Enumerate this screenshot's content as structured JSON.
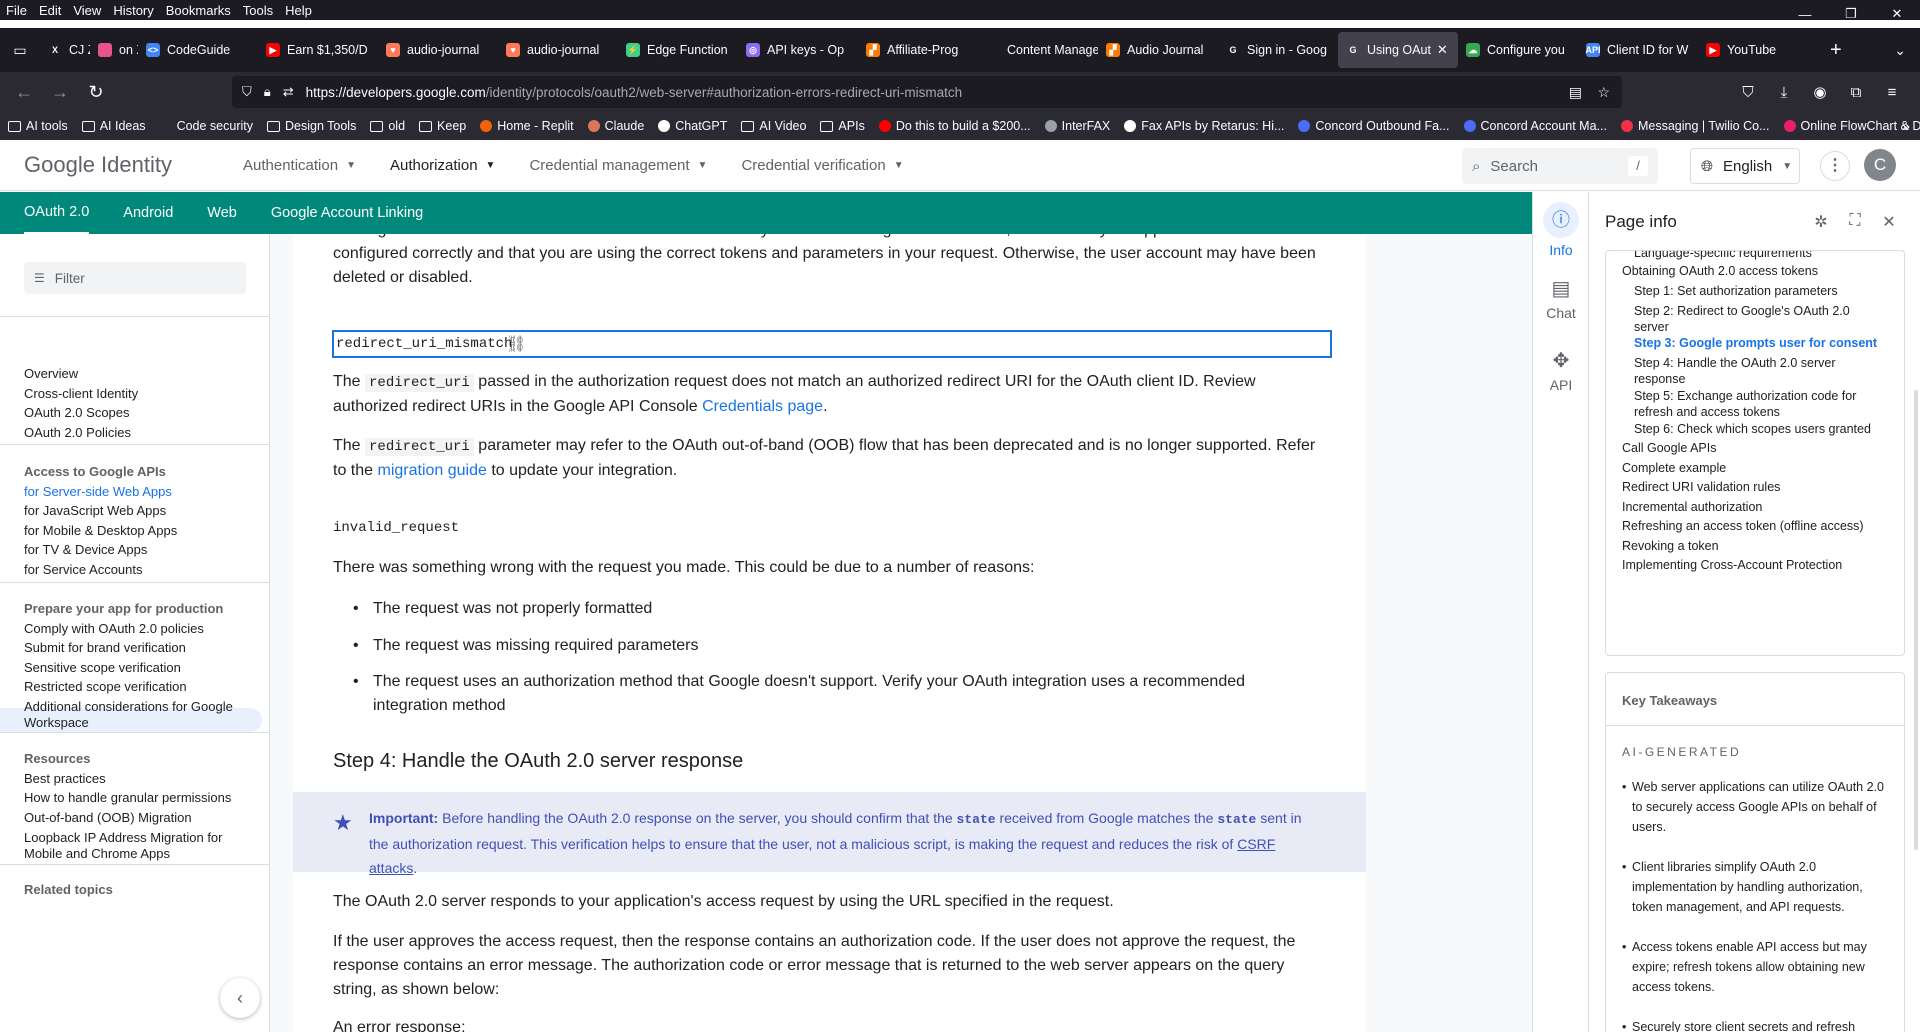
{
  "menubar": {
    "items": [
      "File",
      "Edit",
      "View",
      "History",
      "Bookmarks",
      "Tools",
      "Help"
    ]
  },
  "tabs": [
    {
      "label": "CJ Z",
      "fav_color": "#ffffff",
      "fav_text": "X"
    },
    {
      "label": "on X",
      "fav_color": "#e8538a",
      "fav_text": ""
    },
    {
      "label": "CodeGuide",
      "fav_color": "#4285f4",
      "fav_text": "<>"
    },
    {
      "label": "Earn $1,350/D",
      "fav_color": "#ff0000",
      "fav_text": "▶"
    },
    {
      "label": "audio-journal",
      "fav_color": "#ff7a59",
      "fav_text": "♥"
    },
    {
      "label": "audio-journal",
      "fav_color": "#ff7a59",
      "fav_text": "♥"
    },
    {
      "label": "Edge Function",
      "fav_color": "#3ecf8e",
      "fav_text": "⚡"
    },
    {
      "label": "API keys - Op",
      "fav_color": "#8e6cef",
      "fav_text": "◎"
    },
    {
      "label": "Affiliate-Prog",
      "fav_color": "#ff7a00",
      "fav_text": "▞"
    },
    {
      "label": "Content Manager",
      "fav_color": "#1c1b22",
      "fav_text": ""
    },
    {
      "label": "Audio Journal",
      "fav_color": "#ff7a00",
      "fav_text": "▞"
    },
    {
      "label": "Sign in - Goog",
      "fav_color": "#ffffff",
      "fav_text": "G"
    },
    {
      "label": "Using OAut",
      "fav_color": "#ffffff",
      "fav_text": "G",
      "active": true
    },
    {
      "label": "Configure you",
      "fav_color": "#34a853",
      "fav_text": "☁"
    },
    {
      "label": "Client ID for W",
      "fav_color": "#4285f4",
      "fav_text": "API"
    },
    {
      "label": "YouTube",
      "fav_color": "#ff0000",
      "fav_text": "▶"
    }
  ],
  "url": {
    "host": "https://developers.google.com",
    "path": "/identity/protocols/oauth2/web-server#authorization-errors-redirect-uri-mismatch"
  },
  "bookmarks": [
    {
      "label": "AI tools",
      "type": "folder"
    },
    {
      "label": "AI Ideas",
      "type": "folder"
    },
    {
      "label": "Code security",
      "type": "site",
      "color": "#2b2a33"
    },
    {
      "label": "Design Tools",
      "type": "folder"
    },
    {
      "label": "old",
      "type": "folder"
    },
    {
      "label": "Keep",
      "type": "folder"
    },
    {
      "label": "Home - Replit",
      "type": "site",
      "color": "#f26207"
    },
    {
      "label": "Claude",
      "type": "site",
      "color": "#d97757"
    },
    {
      "label": "ChatGPT",
      "type": "site",
      "color": "#ffffff"
    },
    {
      "label": "AI Video",
      "type": "folder"
    },
    {
      "label": "APIs",
      "type": "folder"
    },
    {
      "label": "Do this to build a $200...",
      "type": "site",
      "color": "#ff0000"
    },
    {
      "label": "InterFAX",
      "type": "site",
      "color": "#9aa0a6"
    },
    {
      "label": "Fax APIs by Retarus: Hi...",
      "type": "site",
      "color": "#ffffff"
    },
    {
      "label": "Concord Outbound Fa...",
      "type": "site",
      "color": "#4a6cf7"
    },
    {
      "label": "Concord Account Ma...",
      "type": "site",
      "color": "#4a6cf7"
    },
    {
      "label": "Messaging | Twilio Co...",
      "type": "site",
      "color": "#f22f46"
    },
    {
      "label": "Online FlowChart & Di...",
      "type": "site",
      "color": "#e91e63"
    }
  ],
  "gheader": {
    "logo": "Google Identity",
    "nav": [
      "Authentication",
      "Authorization",
      "Credential management",
      "Credential verification"
    ],
    "active_nav": "Authorization",
    "search_placeholder": "Search",
    "search_shortcut": "/",
    "language": "English",
    "avatar": "C"
  },
  "subnav": [
    "OAuth 2.0",
    "Android",
    "Web",
    "Google Account Linking"
  ],
  "leftnav": {
    "filter_placeholder": "Filter",
    "items": [
      {
        "label": "Overview"
      },
      {
        "label": "Cross-client Identity"
      },
      {
        "label": "OAuth 2.0 Scopes"
      },
      {
        "label": "OAuth 2.0 Policies"
      },
      {
        "label": "Access to Google APIs",
        "head": true
      },
      {
        "label": "for Server-side Web Apps",
        "selected": true
      },
      {
        "label": "for JavaScript Web Apps"
      },
      {
        "label": "for Mobile & Desktop Apps"
      },
      {
        "label": "for TV & Device Apps"
      },
      {
        "label": "for Service Accounts"
      },
      {
        "label": "Prepare your app for production",
        "head": true
      },
      {
        "label": "Comply with OAuth 2.0 policies"
      },
      {
        "label": "Submit for brand verification"
      },
      {
        "label": "Sensitive scope verification"
      },
      {
        "label": "Restricted scope verification"
      },
      {
        "label": "Additional considerations for Google Workspace"
      },
      {
        "label": "Resources",
        "head": true
      },
      {
        "label": "Best practices"
      },
      {
        "label": "How to handle granular permissions"
      },
      {
        "label": "Out-of-band (OOB) Migration"
      },
      {
        "label": "Loopback IP Address Migration for Mobile and Chrome Apps"
      },
      {
        "label": "Related topics",
        "head": true
      }
    ]
  },
  "article": {
    "p_top": "configured correctly and that you are using the correct tokens and parameters in your request. Otherwise, the user account may have been deleted or disabled.",
    "p_top_clipped": "user again and ask for user consent to obtain new tokens. If you are continuing to see this error, ensure that your application has been",
    "err1": "redirect_uri_mismatch",
    "p1_a": "The ",
    "p1_code": "redirect_uri",
    "p1_b": " passed in the authorization request does not match an authorized redirect URI for the OAuth client ID. Review authorized redirect URIs in the Google API Console ",
    "p1_link": "Credentials page",
    "p1_c": ".",
    "p2_a": "The ",
    "p2_code": "redirect_uri",
    "p2_b": " parameter may refer to the OAuth out-of-band (OOB) flow that has been deprecated and is no longer supported. Refer to the ",
    "p2_link": "migration guide",
    "p2_c": " to update your integration.",
    "err2": "invalid_request",
    "p3": "There was something wrong with the request you made. This could be due to a number of reasons:",
    "bullets": [
      "The request was not properly formatted",
      "The request was missing required parameters",
      "The request uses an authorization method that Google doesn't support. Verify your OAuth integration uses a recommended integration method"
    ],
    "h2": "Step 4: Handle the OAuth 2.0 server response",
    "note_label": "Important:",
    "note_a": " Before handling the OAuth 2.0 response on the server, you should confirm that the ",
    "note_code1": "state",
    "note_b": " received from Google matches the ",
    "note_code2": "state",
    "note_c": " sent in the authorization request. This verification helps to ensure that the user, not a malicious script, is making the request and reduces the risk of ",
    "note_link": "CSRF attacks",
    "note_d": ".",
    "p4": "The OAuth 2.0 server responds to your application's access request by using the URL specified in the request.",
    "p5": "If the user approves the access request, then the response contains an authorization code. If the user does not approve the request, the response contains an error message. The authorization code or error message that is returned to the web server appears on the query string, as shown below:",
    "p6": "An error response:"
  },
  "sidetabs": [
    {
      "label": "Info",
      "icon": "info-icon",
      "active": true
    },
    {
      "label": "Chat",
      "icon": "chat-icon"
    },
    {
      "label": "API",
      "icon": "api-icon"
    }
  ],
  "panel": {
    "title": "Page info",
    "toc": [
      {
        "label": "Language-specific requirements",
        "sub": true,
        "clipped": true
      },
      {
        "label": "Obtaining OAuth 2.0 access tokens"
      },
      {
        "label": "Step 1: Set authorization parameters",
        "sub": true
      },
      {
        "label": "Step 2: Redirect to Google's OAuth 2.0 server",
        "sub": true
      },
      {
        "label": "Step 3: Google prompts user for consent",
        "sub": true,
        "current": true
      },
      {
        "label": "Step 4: Handle the OAuth 2.0 server response",
        "sub": true
      },
      {
        "label": "Step 5: Exchange authorization code for refresh and access tokens",
        "sub": true
      },
      {
        "label": "Step 6: Check which scopes users granted",
        "sub": true
      },
      {
        "label": "Call Google APIs"
      },
      {
        "label": "Complete example"
      },
      {
        "label": "Redirect URI validation rules"
      },
      {
        "label": "Incremental authorization"
      },
      {
        "label": "Refreshing an access token (offline access)"
      },
      {
        "label": "Revoking a token"
      },
      {
        "label": "Implementing Cross-Account Protection"
      }
    ],
    "key_takeaways_title": "Key Takeaways",
    "ai_generated": "AI-GENERATED",
    "takeaways": [
      "Web server applications can utilize OAuth 2.0 to securely access Google APIs on behalf of users.",
      "Client libraries simplify OAuth 2.0 implementation by handling authorization, token management, and API requests.",
      "Access tokens enable API access but may expire; refresh tokens allow obtaining new access tokens.",
      "Securely store client secrets and refresh tokens to protect user data."
    ]
  }
}
